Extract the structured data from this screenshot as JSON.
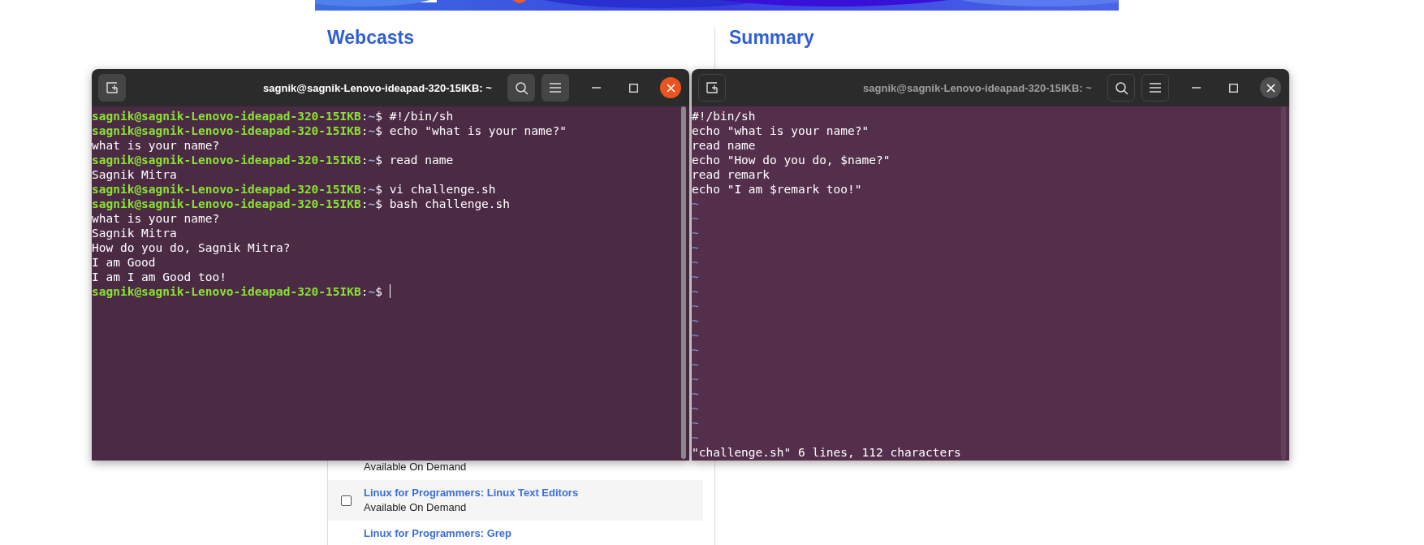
{
  "page": {
    "webcasts": {
      "heading": "Webcasts",
      "items": [
        {
          "status": "Available On Demand"
        },
        {
          "title": "Linux for Programmers: Linux Text Editors",
          "status": "Available On Demand",
          "checked": false,
          "hovered": true
        },
        {
          "title": "Linux for Programmers: Grep"
        }
      ]
    },
    "summary": {
      "heading": "Summary"
    }
  },
  "windows": [
    {
      "title": "sagnik@sagnik-Lenovo-ideapad-320-15IKB: ~",
      "active": true,
      "lines": [
        {
          "kind": "prompt",
          "user_host": "sagnik@sagnik-Lenovo-ideapad-320-15IKB",
          "colon": ":",
          "path": "~",
          "symbol": "$",
          "command": "#!/bin/sh"
        },
        {
          "kind": "prompt",
          "user_host": "sagnik@sagnik-Lenovo-ideapad-320-15IKB",
          "colon": ":",
          "path": "~",
          "symbol": "$",
          "command": "echo \"what is your name?\""
        },
        {
          "kind": "output",
          "text": "what is your name?"
        },
        {
          "kind": "prompt",
          "user_host": "sagnik@sagnik-Lenovo-ideapad-320-15IKB",
          "colon": ":",
          "path": "~",
          "symbol": "$",
          "command": "read name"
        },
        {
          "kind": "output",
          "text": "Sagnik Mitra"
        },
        {
          "kind": "prompt",
          "user_host": "sagnik@sagnik-Lenovo-ideapad-320-15IKB",
          "colon": ":",
          "path": "~",
          "symbol": "$",
          "command": "vi challenge.sh"
        },
        {
          "kind": "prompt",
          "user_host": "sagnik@sagnik-Lenovo-ideapad-320-15IKB",
          "colon": ":",
          "path": "~",
          "symbol": "$",
          "command": "bash challenge.sh"
        },
        {
          "kind": "output",
          "text": "what is your name?"
        },
        {
          "kind": "output",
          "text": "Sagnik Mitra"
        },
        {
          "kind": "output",
          "text": "How do you do, Sagnik Mitra?"
        },
        {
          "kind": "output",
          "text": "I am Good"
        },
        {
          "kind": "output",
          "text": "I am I am Good too!"
        },
        {
          "kind": "prompt",
          "user_host": "sagnik@sagnik-Lenovo-ideapad-320-15IKB",
          "colon": ":",
          "path": "~",
          "symbol": "$",
          "cursor": true
        }
      ]
    },
    {
      "title": "sagnik@sagnik-Lenovo-ideapad-320-15IKB: ~",
      "active": false,
      "lines": [
        {
          "kind": "output",
          "text": "#!/bin/sh"
        },
        {
          "kind": "output",
          "text": "echo \"what is your name?\""
        },
        {
          "kind": "output",
          "text": "read name"
        },
        {
          "kind": "output",
          "text": "echo \"How do you do, $name?\""
        },
        {
          "kind": "output",
          "text": "read remark"
        },
        {
          "kind": "output",
          "text": "echo \"I am $remark too!\""
        },
        {
          "kind": "empty",
          "text": "~"
        },
        {
          "kind": "empty",
          "text": "~"
        },
        {
          "kind": "empty",
          "text": "~"
        },
        {
          "kind": "empty",
          "text": "~"
        },
        {
          "kind": "empty",
          "text": "~"
        },
        {
          "kind": "empty",
          "text": "~"
        },
        {
          "kind": "empty",
          "text": "~"
        },
        {
          "kind": "empty",
          "text": "~"
        },
        {
          "kind": "empty",
          "text": "~"
        },
        {
          "kind": "empty",
          "text": "~"
        },
        {
          "kind": "empty",
          "text": "~"
        },
        {
          "kind": "empty",
          "text": "~"
        },
        {
          "kind": "empty",
          "text": "~"
        },
        {
          "kind": "empty",
          "text": "~"
        },
        {
          "kind": "empty",
          "text": "~"
        },
        {
          "kind": "empty",
          "text": "~"
        },
        {
          "kind": "empty",
          "text": "~"
        },
        {
          "kind": "status",
          "text": "\"challenge.sh\" 6 lines, 112 characters"
        }
      ]
    }
  ]
}
